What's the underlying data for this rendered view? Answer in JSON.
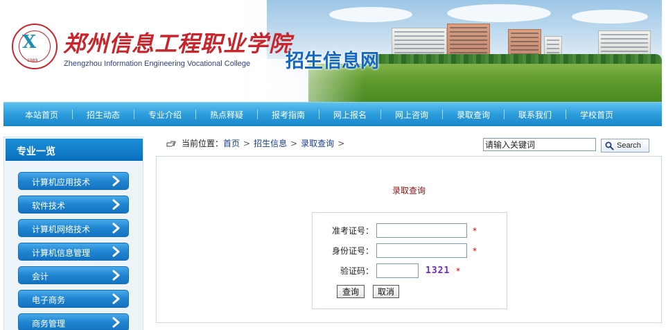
{
  "header": {
    "college_name_cn": "郑州信息工程职业学院",
    "college_name_en": "Zhengzhou Information Engineering Vocational College",
    "logo_year": "1989",
    "section_title": "招生信息网"
  },
  "nav": {
    "items": [
      {
        "label": "本站首页"
      },
      {
        "label": "招生动态"
      },
      {
        "label": "专业介绍"
      },
      {
        "label": "热点释疑"
      },
      {
        "label": "报考指南"
      },
      {
        "label": "网上报名"
      },
      {
        "label": "网上咨询"
      },
      {
        "label": "录取查询"
      },
      {
        "label": "联系我们"
      },
      {
        "label": "学校首页"
      }
    ]
  },
  "sidebar": {
    "title": "专业一览",
    "items": [
      {
        "label": "计算机应用技术"
      },
      {
        "label": "软件技术"
      },
      {
        "label": "计算机网络技术"
      },
      {
        "label": "计算机信息管理"
      },
      {
        "label": "会计"
      },
      {
        "label": "电子商务"
      },
      {
        "label": "商务管理"
      }
    ]
  },
  "breadcrumb": {
    "prefix": "当前位置：",
    "items": [
      {
        "label": "首页"
      },
      {
        "label": "招生信息"
      },
      {
        "label": "录取查询"
      }
    ],
    "separator": ">"
  },
  "search": {
    "value": "请输入关键词",
    "button_label": "Search"
  },
  "main": {
    "title": "录取查询",
    "form": {
      "exam_no_label": "准考证号：",
      "id_no_label": "身份证号：",
      "captcha_label": "验证码：",
      "required_mark": "*",
      "captcha_text": "1321",
      "query_button": "查询",
      "cancel_button": "取消"
    }
  },
  "colors": {
    "nav_blue": "#2c9ddc",
    "sidebar_button_blue": "#1f85d2",
    "title_dark_red": "#8b1010",
    "required_red": "#cc0000",
    "link_blue": "#1a3d8f"
  }
}
